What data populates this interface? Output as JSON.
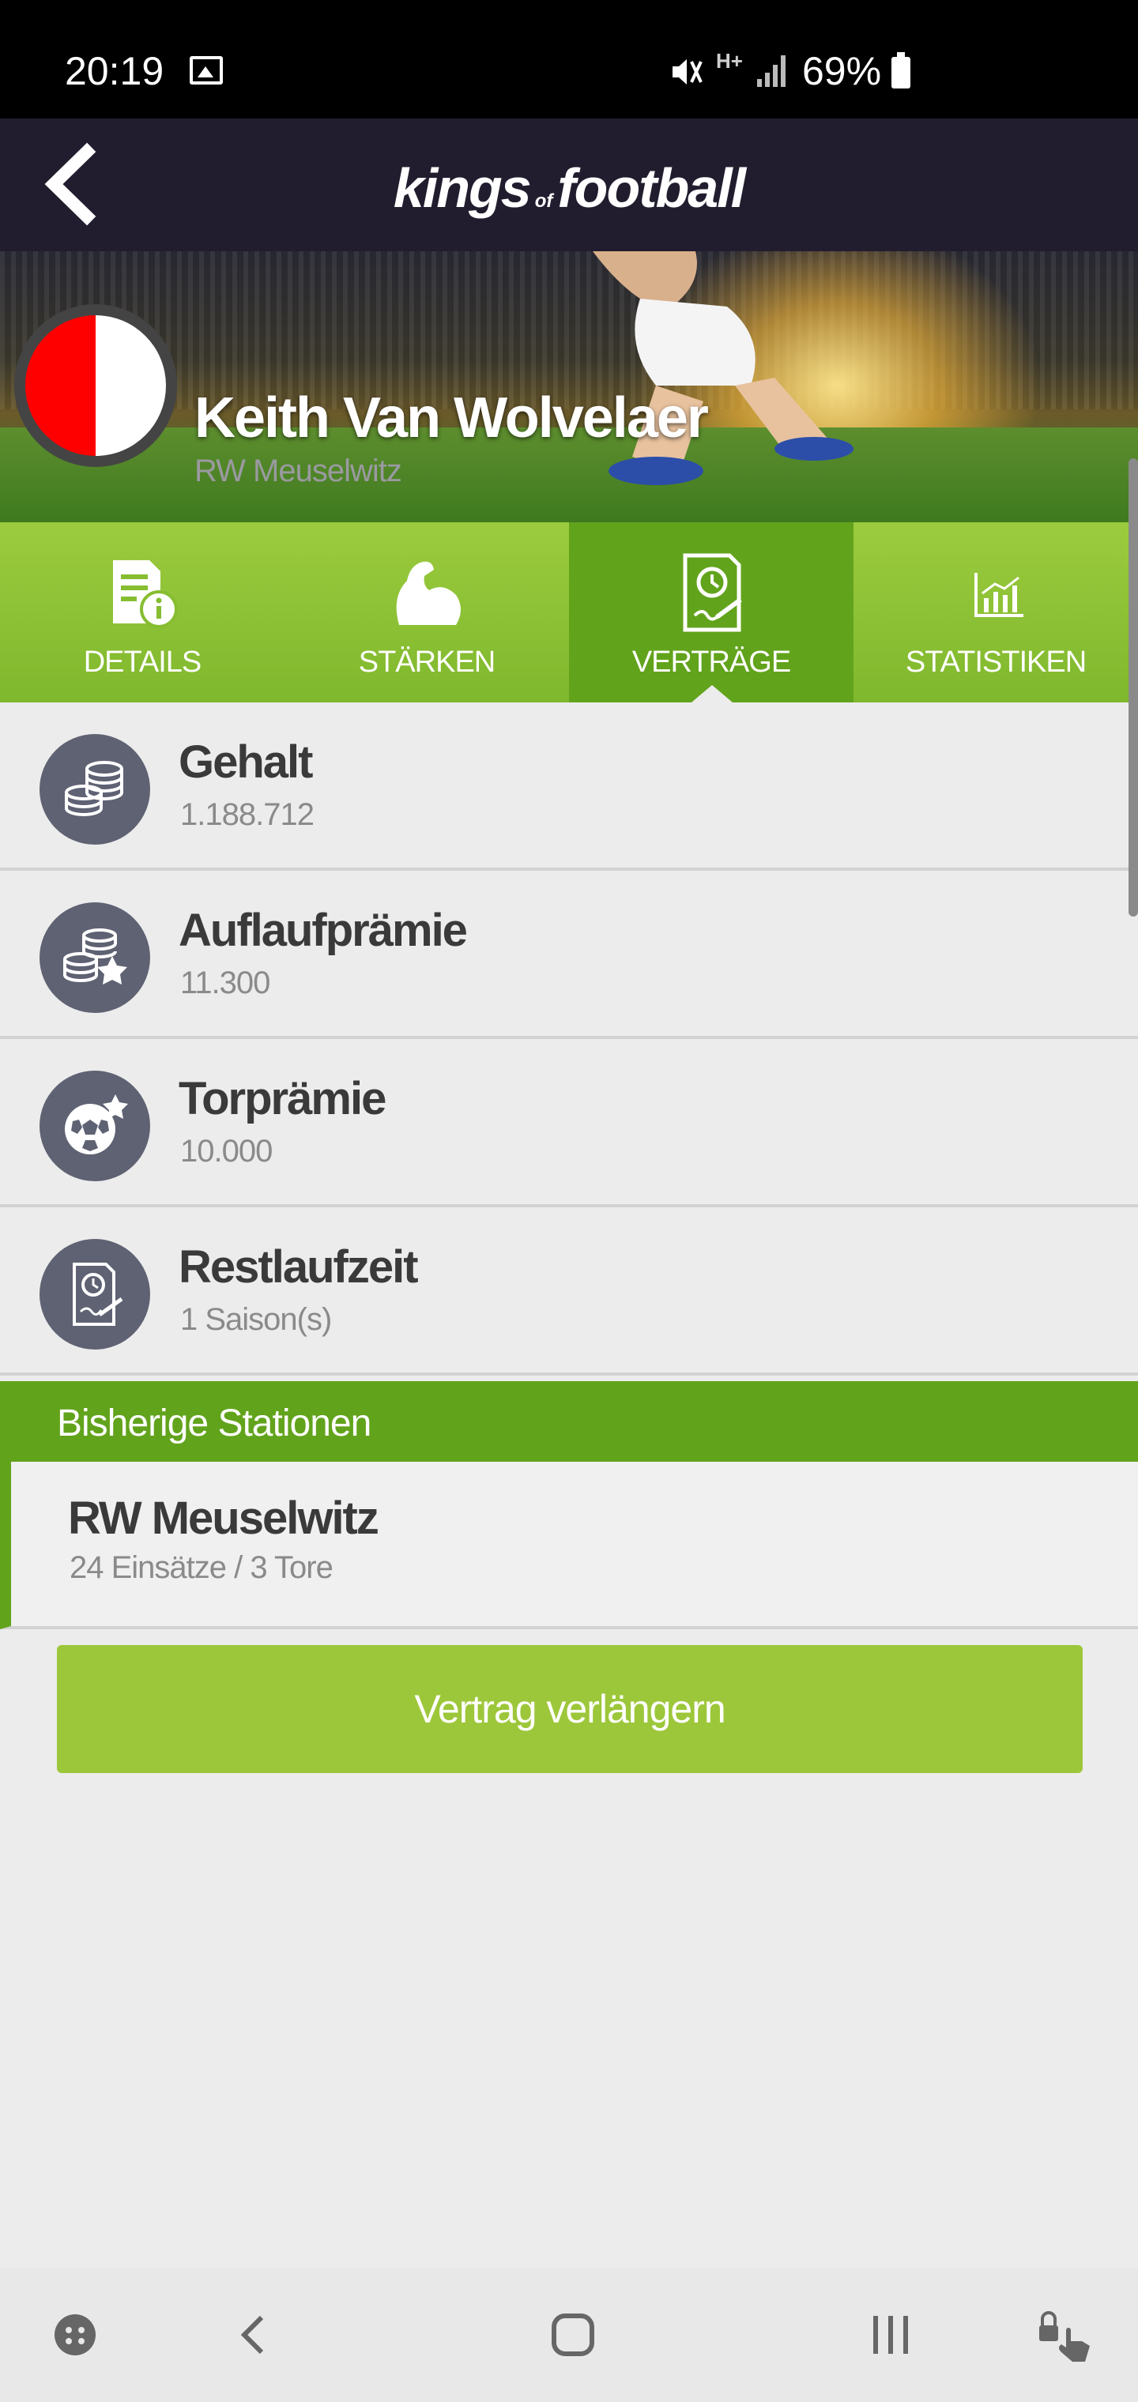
{
  "status_bar": {
    "time": "20:19",
    "network": "H+",
    "battery": "69%"
  },
  "header": {
    "brand_big_1": "kings",
    "brand_small": "of",
    "brand_big_2": "football"
  },
  "player": {
    "name": "Keith Van Wolvelaer",
    "club": "RW Meuselwitz",
    "badge_colors": [
      "#ff0000",
      "#ffffff"
    ]
  },
  "tabs": [
    {
      "label": "DETAILS",
      "icon": "details-icon",
      "active": false
    },
    {
      "label": "STÄRKEN",
      "icon": "strength-icon",
      "active": false
    },
    {
      "label": "VERTRÄGE",
      "icon": "contract-icon",
      "active": true
    },
    {
      "label": "STATISTIKEN",
      "icon": "statistics-icon",
      "active": false
    }
  ],
  "contract": {
    "items": [
      {
        "title": "Gehalt",
        "value": "1.188.712",
        "icon": "coins-icon"
      },
      {
        "title": "Auflaufprämie",
        "value": "11.300",
        "icon": "coins-star-icon"
      },
      {
        "title": "Torprämie",
        "value": "10.000",
        "icon": "ball-star-icon"
      },
      {
        "title": "Restlaufzeit",
        "value": "1 Saison(s)",
        "icon": "contract-clock-icon"
      }
    ]
  },
  "stations": {
    "header": "Bisherige Stationen",
    "items": [
      {
        "club": "RW Meuselwitz",
        "stats": "24 Einsätze / 3 Tore"
      }
    ]
  },
  "actions": {
    "extend_label": "Vertrag verlängern"
  },
  "colors": {
    "header_bg": "#221d2e",
    "tab_green": "#8cc234",
    "active_green": "#62a31c",
    "button_green": "#9dc73a",
    "icon_circle": "#5e6273"
  }
}
